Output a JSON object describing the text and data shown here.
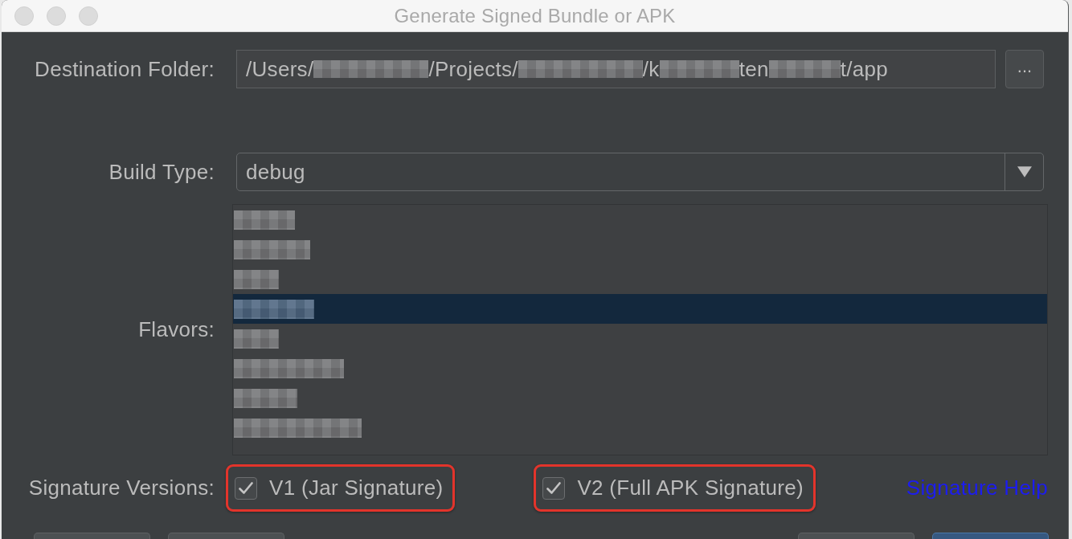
{
  "window": {
    "title": "Generate Signed Bundle or APK"
  },
  "destination_folder": {
    "label": "Destination Folder:",
    "path": [
      {
        "kind": "text",
        "text": "/Users/"
      },
      {
        "kind": "redacted"
      },
      {
        "kind": "text",
        "text": "/Projects/"
      },
      {
        "kind": "redacted"
      },
      {
        "kind": "text",
        "text": "/k"
      },
      {
        "kind": "redacted"
      },
      {
        "kind": "text",
        "text": "ten"
      },
      {
        "kind": "redacted"
      },
      {
        "kind": "text",
        "text": "t/app"
      }
    ],
    "browse_button": "..."
  },
  "build_type": {
    "label": "Build Type:",
    "value": "debug"
  },
  "flavors": {
    "label": "Flavors:",
    "items": [
      {
        "selected": false
      },
      {
        "selected": false
      },
      {
        "selected": false
      },
      {
        "selected": true
      },
      {
        "selected": false
      },
      {
        "selected": false
      },
      {
        "selected": false
      },
      {
        "selected": false
      }
    ]
  },
  "signature_versions": {
    "label": "Signature Versions:",
    "options": [
      {
        "label": "V1 (Jar Signature)",
        "checked": true,
        "highlighted": true
      },
      {
        "label": "V2 (Full APK Signature)",
        "checked": true,
        "highlighted": true
      }
    ],
    "help_link": "Signature Help"
  },
  "footer_buttons": [
    {
      "kind": "default"
    },
    {
      "kind": "default"
    },
    {
      "kind": "default"
    },
    {
      "kind": "primary"
    }
  ]
}
